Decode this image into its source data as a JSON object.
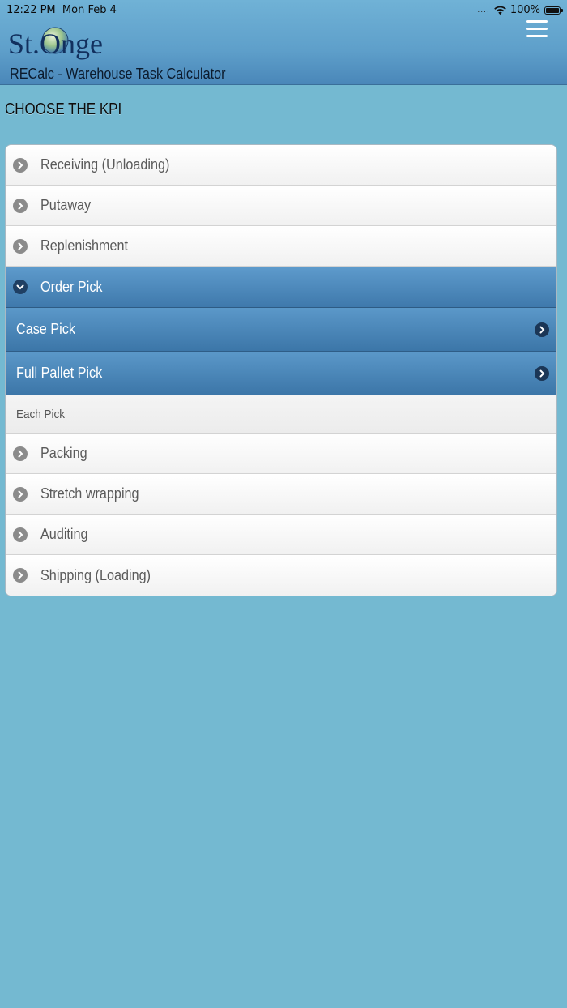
{
  "status_bar": {
    "time": "12:22 PM",
    "date": "Mon Feb 4",
    "signal": "....",
    "battery": "100%"
  },
  "header": {
    "app_title": "RECalc - Warehouse Task Calculator",
    "logo_text": "St.Onge"
  },
  "section": {
    "heading": "CHOOSE THE KPI"
  },
  "kpi": {
    "receiving": "Receiving (Unloading)",
    "putaway": "Putaway",
    "replenishment": "Replenishment",
    "order_pick": "Order Pick",
    "order_pick_sub": {
      "case_pick": "Case Pick",
      "full_pallet_pick": "Full Pallet Pick",
      "each_pick": "Each Pick"
    },
    "packing": "Packing",
    "stretch_wrapping": "Stretch wrapping",
    "auditing": "Auditing",
    "shipping": "Shipping (Loading)"
  },
  "colors": {
    "background": "#74b9d1",
    "header_accent": "#5e9fca",
    "selected_row": "#3f79ac"
  }
}
